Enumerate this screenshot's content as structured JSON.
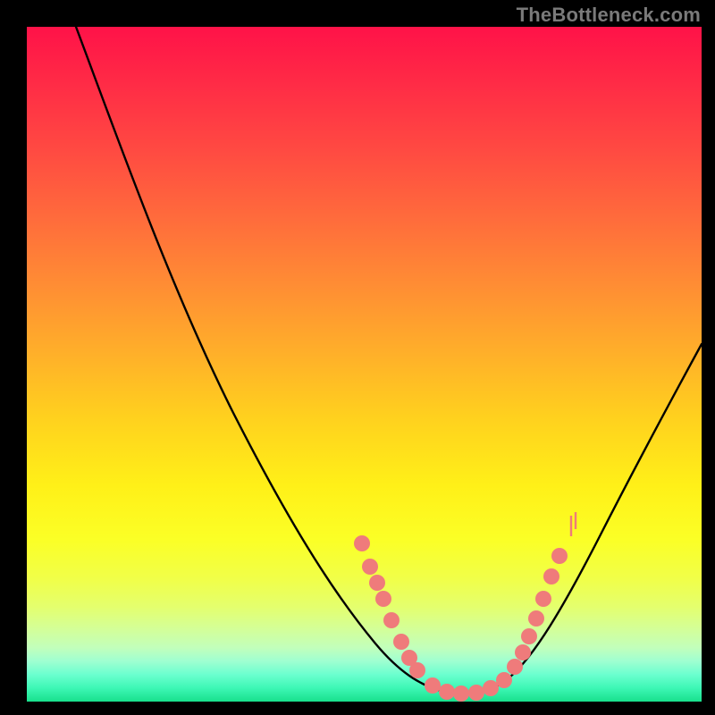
{
  "watermark": "TheBottleneck.com",
  "chart_data": {
    "type": "line",
    "title": "",
    "xlabel": "",
    "ylabel": "",
    "xlim": [
      0,
      1
    ],
    "ylim": [
      0,
      1
    ],
    "x": [
      0.0,
      0.05,
      0.1,
      0.15,
      0.2,
      0.25,
      0.3,
      0.35,
      0.4,
      0.45,
      0.5,
      0.55,
      0.57,
      0.6,
      0.62,
      0.65,
      0.68,
      0.7,
      0.73,
      0.77,
      0.82,
      0.88,
      0.94,
      1.0
    ],
    "y": [
      1.0,
      0.97,
      0.91,
      0.84,
      0.76,
      0.67,
      0.58,
      0.49,
      0.4,
      0.31,
      0.22,
      0.13,
      0.08,
      0.04,
      0.02,
      0.01,
      0.01,
      0.02,
      0.05,
      0.12,
      0.23,
      0.35,
      0.45,
      0.53
    ],
    "markers": {
      "left_band_x": [
        0.49,
        0.51,
        0.52,
        0.53,
        0.55,
        0.57,
        0.58,
        0.59
      ],
      "left_band_y": [
        0.23,
        0.19,
        0.17,
        0.14,
        0.1,
        0.07,
        0.05,
        0.04
      ],
      "floor_x": [
        0.6,
        0.62,
        0.64,
        0.66,
        0.68,
        0.7
      ],
      "floor_y": [
        0.02,
        0.01,
        0.01,
        0.01,
        0.01,
        0.02
      ],
      "right_band_x": [
        0.72,
        0.73,
        0.74,
        0.76,
        0.77,
        0.79,
        0.8
      ],
      "right_band_y": [
        0.05,
        0.07,
        0.1,
        0.13,
        0.16,
        0.19,
        0.22
      ],
      "marker_color": "#ef7b7b"
    },
    "background_gradient": [
      "#ff1248",
      "#ffae2a",
      "#fff018",
      "#18e08c"
    ]
  }
}
